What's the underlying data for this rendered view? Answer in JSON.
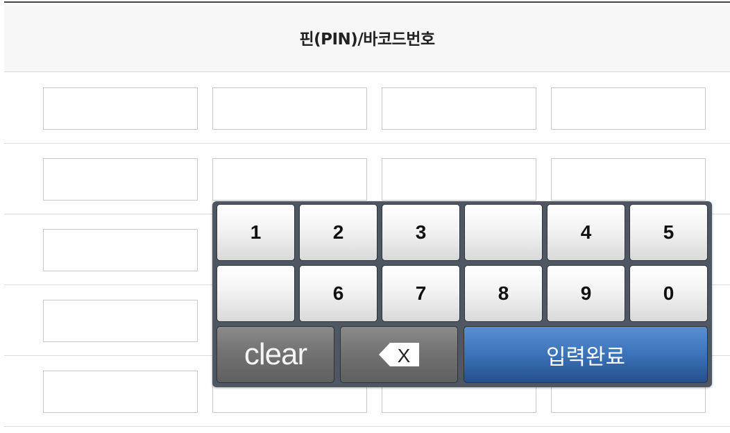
{
  "header": {
    "title": "핀(PIN)/바코드번호"
  },
  "keypad": {
    "row1": [
      "1",
      "2",
      "3",
      "",
      "4",
      "5"
    ],
    "row2": [
      "",
      "6",
      "7",
      "8",
      "9",
      "0"
    ],
    "clear_label": "clear",
    "backspace_icon": "backspace-icon",
    "backspace_glyph": "X",
    "confirm_label": "입력완료"
  }
}
